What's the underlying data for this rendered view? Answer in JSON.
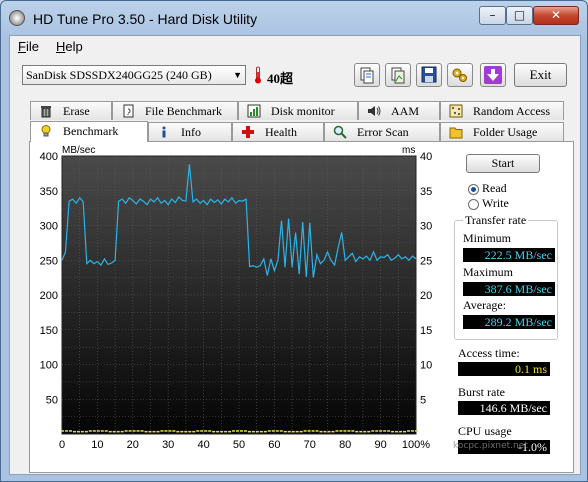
{
  "window": {
    "title": "HD Tune Pro 3.50 - Hard Disk Utility"
  },
  "menu": [
    {
      "label": "File",
      "u": "F",
      "rest": "ile"
    },
    {
      "label": "Help",
      "u": "H",
      "rest": "elp"
    }
  ],
  "toolbar": {
    "drive": "SanDisk SDSSDX240GG25 (240 GB)",
    "temperature": "40超",
    "exit_label": "Exit"
  },
  "tabs_top": [
    "Erase",
    "File Benchmark",
    "Disk monitor",
    "AAM",
    "Random Access"
  ],
  "tabs_bottom": [
    "Benchmark",
    "Info",
    "Health",
    "Error Scan",
    "Folder Usage"
  ],
  "active_tab": "Benchmark",
  "controls": {
    "start_label": "Start",
    "mode_options": [
      "Read",
      "Write"
    ],
    "mode_selected": "Read"
  },
  "stats": {
    "transfer_rate_title": "Transfer rate",
    "minimum_label": "Minimum",
    "minimum": "222.5 MB/sec",
    "maximum_label": "Maximum",
    "maximum": "387.6 MB/sec",
    "average_label": "Average:",
    "average": "289.2 MB/sec",
    "access_time_label": "Access time:",
    "access_time": "0.1 ms",
    "burst_rate_label": "Burst rate",
    "burst_rate": "146.6 MB/sec",
    "cpu_usage_label": "CPU usage",
    "cpu_usage": "-1.0%"
  },
  "watermark": "kocpc.pixnet.net",
  "colors": {
    "plot_bg": "#000000",
    "read_line": "#2ab4e8",
    "access_points": "#e6e04a"
  },
  "chart_data": {
    "type": "line",
    "y_left_label": "MB/sec",
    "y_right_label": "ms",
    "y_left_ticks": [
      "400",
      "350",
      "300",
      "250",
      "200",
      "150",
      "100",
      "50"
    ],
    "y_right_ticks": [
      "40",
      "35",
      "30",
      "25",
      "20",
      "15",
      "10",
      "5"
    ],
    "x_ticks": [
      "0",
      "10",
      "20",
      "30",
      "40",
      "50",
      "60",
      "70",
      "80",
      "90",
      "100%"
    ],
    "ylim": [
      0,
      400
    ],
    "y2lim": [
      0,
      40
    ],
    "xlim": [
      0,
      100
    ],
    "grid": true,
    "series": [
      {
        "x": [
          0,
          1,
          2,
          3,
          4,
          5,
          6,
          7,
          8,
          9,
          10,
          11,
          12,
          13,
          14,
          15,
          16,
          17,
          18,
          19,
          20,
          21,
          22,
          23,
          24,
          25,
          26,
          27,
          28,
          29,
          30,
          31,
          32,
          33,
          34,
          35,
          36,
          37,
          38,
          39,
          40,
          41,
          42,
          43,
          44,
          45,
          46,
          47,
          48,
          49,
          50,
          51,
          52,
          53,
          54,
          55,
          56,
          57,
          58,
          59,
          60,
          61,
          62,
          63,
          64,
          65,
          66,
          67,
          68,
          69,
          70,
          71,
          72,
          73,
          74,
          75,
          76,
          77,
          78,
          79,
          80,
          81,
          82,
          83,
          84,
          85,
          86,
          87,
          88,
          89,
          90,
          91,
          92,
          93,
          94,
          95,
          96,
          97,
          98,
          99,
          100
        ],
        "values": [
          250,
          262,
          335,
          338,
          332,
          340,
          334,
          245,
          250,
          245,
          248,
          243,
          252,
          244,
          246,
          250,
          335,
          338,
          332,
          340,
          336,
          331,
          338,
          335,
          330,
          338,
          334,
          340,
          332,
          336,
          330,
          338,
          333,
          341,
          336,
          335,
          388,
          334,
          338,
          332,
          336,
          330,
          338,
          333,
          337,
          331,
          338,
          334,
          340,
          332,
          336,
          335,
          338,
          241,
          242,
          240,
          242,
          252,
          228,
          252,
          235,
          250,
          307,
          240,
          310,
          240,
          290,
          230,
          305,
          226,
          304,
          225,
          258,
          245,
          250,
          262,
          250,
          243,
          268,
          290,
          250,
          255,
          260,
          248,
          255,
          252,
          256,
          250,
          262,
          250,
          255,
          254,
          258,
          250,
          253,
          258,
          252,
          255,
          250,
          256,
          252
        ]
      },
      {
        "x": [
          0,
          5,
          10,
          15,
          20,
          25,
          30,
          35,
          40,
          45,
          50,
          55,
          60,
          65,
          70,
          75,
          80,
          85,
          90,
          95,
          100
        ],
        "values": [
          0.4,
          0.3,
          0.4,
          0.3,
          0.4,
          0.3,
          0.4,
          0.3,
          0.4,
          0.3,
          0.4,
          0.3,
          0.4,
          0.3,
          0.4,
          0.3,
          0.4,
          0.3,
          0.4,
          0.3,
          0.4
        ]
      }
    ]
  }
}
